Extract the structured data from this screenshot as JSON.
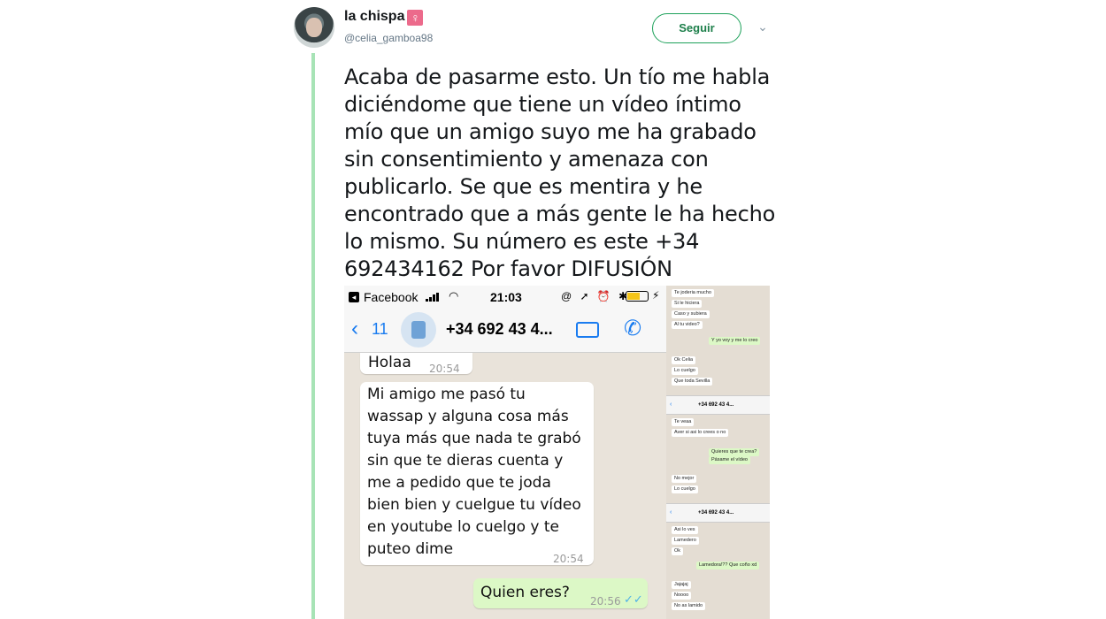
{
  "author": {
    "display_name": "la chispa",
    "venus_glyph": "♀",
    "handle": "@celia_gamboa98"
  },
  "follow_button": "Seguir",
  "menu_icon": "chevron-down-icon",
  "tweet_text_lines": [
    "Acaba de pasarme esto. Un tío me habla",
    "diciéndome que tiene un vídeo íntimo",
    "mío que un amigo suyo me ha grabado",
    "sin consentimiento y amenaza con",
    "publicarlo. Se que es mentira y he",
    "encontrado que a más gente le ha hecho",
    "lo mismo. Su número es este +34",
    "692434162  Por favor DIFUSIÓN"
  ],
  "screenshot": {
    "status": {
      "app": "Facebook",
      "time": "21:03",
      "icons": "@ ➚ ⏰ ✱"
    },
    "header": {
      "back_count": "11",
      "contact": "+34 692 43 4..."
    },
    "messages": [
      {
        "text": "Holaa",
        "time": "20:54"
      },
      {
        "lines": [
          "Mi amigo me pasó tu",
          "wassap y alguna cosa más",
          "tuya más que nada te grabó",
          "sin que te dieras cuenta y",
          "me a pedido que te joda",
          "bien bien y cuelgue tu vídeo",
          "en youtube lo cuelgo y te",
          "puteo dime"
        ],
        "time": "20:54"
      },
      {
        "text": "Quien eres?",
        "time": "20:56",
        "ticks": "✓✓"
      }
    ]
  },
  "side_panel": {
    "bubbles_1": [
      "Te joderia mucho",
      "Si le hiciera",
      "Caso y subiera",
      "Al tu video?"
    ],
    "green_1": "Y yo voy y me lo creo",
    "bubbles_2": [
      "Ok Celia",
      "Lo cuelgo",
      "Que toda Sevilla"
    ],
    "header_1": "+34 692 43 4...",
    "bubbles_3": [
      "Te veaa",
      "Aver si asi lo crees o no"
    ],
    "green_2": [
      "Quieres que te crea?",
      "Pásame el vídeo"
    ],
    "bubbles_4": [
      "No mejor",
      "Lo cuelgo"
    ],
    "header_2": "+34 692 43 4...",
    "bubbles_5": [
      "Asi lo ves",
      "Lamedero",
      "Ok"
    ],
    "green_3": "Lamedora!?? Que coño xd",
    "bubbles_6": [
      "Jajajaj",
      "Noooo",
      "No as lamido"
    ]
  }
}
